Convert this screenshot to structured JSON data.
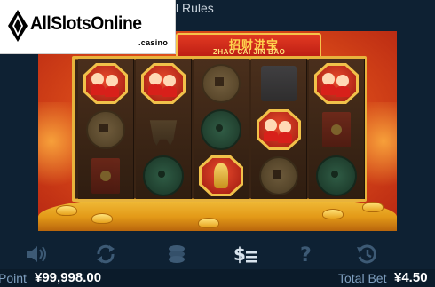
{
  "header": {
    "title_fragment": "l Rules"
  },
  "logo": {
    "brand": "AllSlotsOnline",
    "sub": ".casino"
  },
  "game": {
    "title_cn": "招财进宝",
    "title_en": "ZHAO CAI JIN BAO",
    "reels": [
      [
        "kids",
        "coin",
        "envelope"
      ],
      [
        "kids",
        "tripod",
        "jade"
      ],
      [
        "coin",
        "jade",
        "god"
      ],
      [
        "blue",
        "kids",
        "coin"
      ],
      [
        "kids",
        "envelope",
        "jade"
      ]
    ]
  },
  "toolbar": {
    "items": [
      {
        "icon": "sound-icon"
      },
      {
        "icon": "autoplay-icon"
      },
      {
        "icon": "coins-icon"
      },
      {
        "icon": "paytable-icon"
      },
      {
        "icon": "help-icon"
      },
      {
        "icon": "history-icon"
      }
    ]
  },
  "status": {
    "point_label": "Point",
    "point_value": "¥99,998.00",
    "bet_label": "Total Bet",
    "bet_value": "¥4.50"
  },
  "colors": {
    "bg": "#0e2133",
    "frame_gold": "#e8b33c",
    "accent_red": "#d8201a"
  }
}
